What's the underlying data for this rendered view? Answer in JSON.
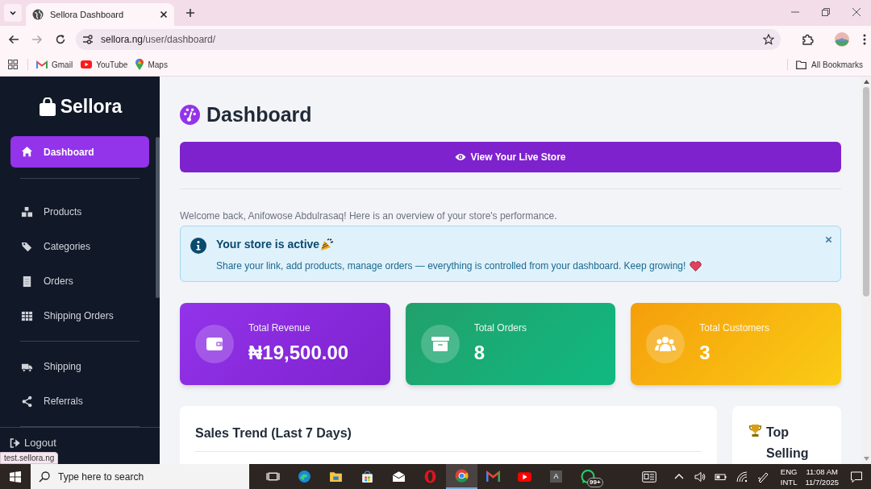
{
  "browser": {
    "tab_title": "Sellora Dashboard",
    "url_host": "sellora.ng",
    "url_path": "/user/dashboard/",
    "bookmarks": [
      "Gmail",
      "YouTube",
      "Maps"
    ],
    "all_bookmarks": "All Bookmarks"
  },
  "sidebar": {
    "brand": "Sellora",
    "groups": [
      [
        {
          "label": "Dashboard",
          "selected": true
        }
      ],
      [
        {
          "label": "Products",
          "selected": false
        },
        {
          "label": "Categories",
          "selected": false
        },
        {
          "label": "Orders",
          "selected": false
        },
        {
          "label": "Shipping Orders",
          "selected": false
        }
      ],
      [
        {
          "label": "Shipping",
          "selected": false
        },
        {
          "label": "Referrals",
          "selected": false
        }
      ]
    ],
    "logout": "Logout"
  },
  "status_url": "test.sellora.ng",
  "main": {
    "title": "Dashboard",
    "live_store_button": "View Your Live Store",
    "welcome": "Welcome back, Anifowose Abdulrasaq! Here is an overview of your store's performance.",
    "alert": {
      "title": "Your store is active",
      "message": "Share your link, add products, manage orders — everything is controlled from your dashboard. Keep growing!"
    },
    "stats": [
      {
        "label": "Total Revenue",
        "value": "₦19,500.00",
        "color": "#9333ea"
      },
      {
        "label": "Total Orders",
        "value": "8",
        "color": "#22a06b"
      },
      {
        "label": "Total Customers",
        "value": "3",
        "color": "#f59e0b"
      }
    ],
    "sales_card": {
      "title": "Sales Trend (Last 7 Days)"
    },
    "top_card": {
      "title": "Top Selling"
    }
  },
  "taskbar": {
    "search_placeholder": "Type here to search",
    "app_letter": "A",
    "badge": "99+",
    "language": "ENG",
    "layout": "INTL",
    "time": "11:08 AM",
    "date": "11/7/2025"
  }
}
